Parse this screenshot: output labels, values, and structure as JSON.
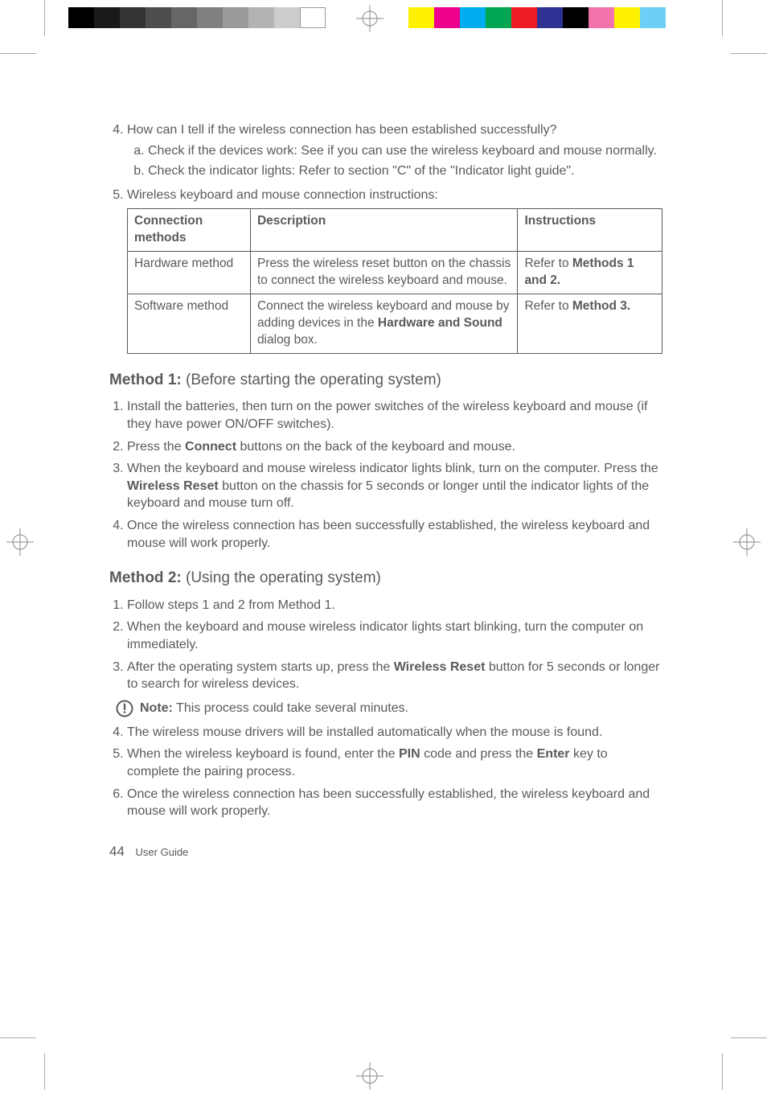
{
  "q4": {
    "text": "How can I tell if the wireless connection has been established successfully?",
    "a": "Check if the devices work: See if you can use the wireless keyboard and mouse normally.",
    "b": "Check the indicator lights: Refer to section \"C\" of the \"Indicator light guide\"."
  },
  "q5": {
    "text": "Wireless keyboard and mouse connection instructions:"
  },
  "table": {
    "h1": "Connection methods",
    "h2": "Description",
    "h3": "Instructions",
    "r1c1": "Hardware method",
    "r1c2": "Press the wireless reset button on the chassis to connect the wireless keyboard and mouse.",
    "r1c3a": "Refer to ",
    "r1c3b": "Methods 1 and 2.",
    "r2c1": "Software method",
    "r2c2a": "Connect the wireless keyboard and mouse by adding devices in the ",
    "r2c2b": "Hardware and Sound",
    "r2c2c": " dialog box.",
    "r2c3a": "Refer to ",
    "r2c3b": "Method 3."
  },
  "m1": {
    "title_lead": "Method 1:",
    "title_rest": " (Before starting the operating system)",
    "s1": "Install the batteries, then turn on the power switches of the wireless keyboard and mouse (if they have power ON/OFF switches).",
    "s2a": "Press the ",
    "s2b": "Connect",
    "s2c": " buttons on the back of the keyboard and mouse.",
    "s3a": "When the keyboard and mouse wireless indicator lights blink, turn on the computer. Press the ",
    "s3b": "Wireless Reset",
    "s3c": " button on the chassis for 5 seconds or longer until the indicator lights of the keyboard and mouse turn off.",
    "s4": "Once the wireless connection has been successfully established, the wireless keyboard and mouse will work properly."
  },
  "m2": {
    "title_lead": "Method 2:",
    "title_rest": " (Using the operating system)",
    "s1": "Follow steps 1 and 2 from Method 1.",
    "s2": "When the keyboard and mouse wireless indicator lights start blinking, turn the computer on immediately.",
    "s3a": "After the operating system starts up, press the ",
    "s3b": "Wireless Reset",
    "s3c": " button for 5 seconds or longer to search for wireless devices.",
    "note_lead": "Note:",
    "note_rest": " This process could take several minutes.",
    "s4": "The wireless mouse drivers will be installed automatically when the mouse is found.",
    "s5a": "When the wireless keyboard is found, enter the ",
    "s5b": "PIN",
    "s5c": " code and press the ",
    "s5d": "Enter",
    "s5e": " key to complete the pairing process.",
    "s6": "Once the wireless connection has been successfully established, the wireless keyboard and mouse will work properly."
  },
  "footer": {
    "page": "44",
    "label": "User Guide"
  }
}
